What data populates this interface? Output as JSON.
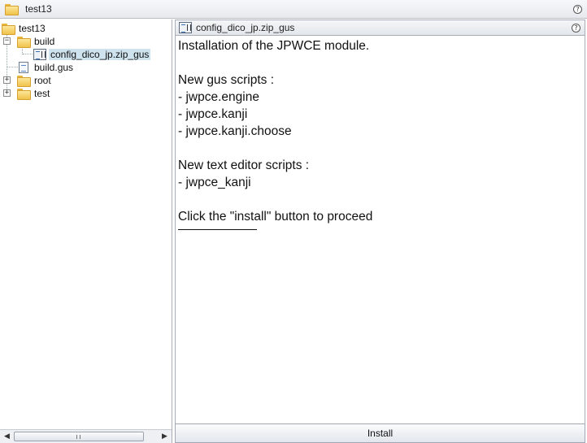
{
  "window": {
    "title": "test13",
    "help_icon": "?"
  },
  "tree": {
    "root_label": "test13",
    "build_folder": "build",
    "selected_item": "config_dico_jp.zip_gus",
    "build_gus": "build.gus",
    "root_folder": "root",
    "test_folder": "test"
  },
  "scrollbar": {
    "left_arrow": "◀",
    "right_arrow": "▶"
  },
  "tab": {
    "title": "config_dico_jp.zip_gus",
    "help_icon": "?"
  },
  "message": {
    "lines": [
      "Installation of the JPWCE module.",
      "",
      "New gus scripts :",
      "- jwpce.engine",
      "- jwpce.kanji",
      "- jwpce.kanji.choose",
      "",
      "New text editor scripts :",
      "- jwpce_kanji",
      "",
      "Click the \"install\" button to proceed"
    ]
  },
  "buttons": {
    "install_label": "Install"
  },
  "icons": [
    "folder-icon",
    "help-icon",
    "script-file-icon",
    "document-icon",
    "expand-icon",
    "collapse-icon",
    "scroll-left-arrow-icon",
    "scroll-right-arrow-icon"
  ]
}
